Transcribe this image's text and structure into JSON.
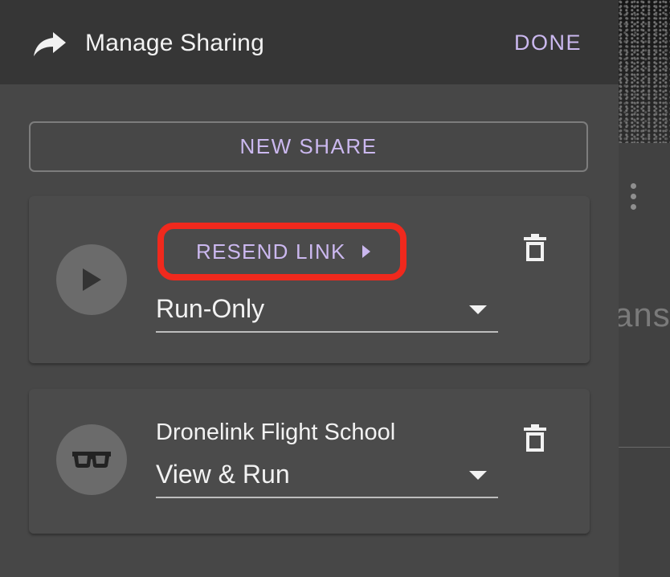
{
  "header": {
    "title": "Manage Sharing",
    "done_label": "DONE",
    "icon": "share-arrow-icon"
  },
  "new_share_label": "NEW SHARE",
  "shares": [
    {
      "avatar_icon": "play-icon",
      "action_label": "RESEND LINK",
      "permission": "Run-Only",
      "highlighted": true
    },
    {
      "avatar_icon": "glasses-icon",
      "name": "Dronelink Flight School",
      "permission": "View & Run"
    }
  ],
  "background": {
    "partial_text": "ans"
  },
  "colors": {
    "accent": "#cbb8ef",
    "highlight": "#f0291d",
    "header_bg": "#363636",
    "panel_bg": "#474747",
    "card_bg": "#4b4b4b"
  }
}
